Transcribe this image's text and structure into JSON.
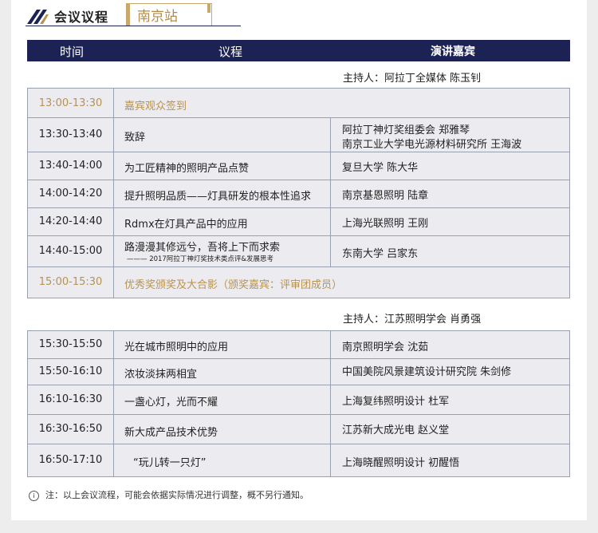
{
  "header": {
    "title": "会议议程",
    "city_tab": "南京站"
  },
  "table_header": {
    "time": "时间",
    "agenda": "议程",
    "speaker": "演讲嘉宾"
  },
  "session1": {
    "host": "主持人：阿拉丁全媒体  陈玉钊",
    "rows": [
      {
        "time": "13:00-13:30",
        "agenda": "嘉宾观众签到",
        "speakers": []
      },
      {
        "time": "13:30-13:40",
        "agenda": "致辞",
        "speakers": [
          "阿拉丁神灯奖组委会  郑雅琴",
          "南京工业大学电光源材料研究所  王海波"
        ]
      },
      {
        "time": "13:40-14:00",
        "agenda": "为工匠精神的照明产品点赞",
        "speakers": [
          "复旦大学  陈大华"
        ]
      },
      {
        "time": "14:00-14:20",
        "agenda": "提升照明品质——灯具研发的根本性追求",
        "speakers": [
          "南京基恩照明  陆章"
        ]
      },
      {
        "time": "14:20-14:40",
        "agenda": "Rdmx在灯具产品中的应用",
        "speakers": [
          "上海光联照明  王刚"
        ]
      },
      {
        "time": "14:40-15:00",
        "agenda": "路漫漫其修远兮，吾将上下而求索",
        "agenda_sub": "——— 2017阿拉丁神灯奖技术类点评&发展思考",
        "speakers": [
          "东南大学  吕家东"
        ]
      },
      {
        "time": "15:00-15:30",
        "agenda": "优秀奖颁奖及大合影（颁奖嘉宾：评审团成员）",
        "speakers": []
      }
    ]
  },
  "session2": {
    "host": "主持人：江苏照明学会  肖勇强",
    "rows": [
      {
        "time": "15:30-15:50",
        "agenda": "光在城市照明中的应用",
        "speakers": [
          "南京照明学会  沈茹"
        ]
      },
      {
        "time": "15:50-16:10",
        "agenda": "浓妆淡抹两相宜",
        "speakers": [
          "中国美院风景建筑设计研究院  朱剑修"
        ]
      },
      {
        "time": "16:10-16:30",
        "agenda": "一盏心灯，光而不耀",
        "speakers": [
          "上海复纬照明设计  杜军"
        ]
      },
      {
        "time": "16:30-16:50",
        "agenda": "新大成产品技术优势",
        "speakers": [
          "江苏新大成光电  赵义堂"
        ]
      },
      {
        "time": "16:50-17:10",
        "agenda": "“玩儿转一只灯”",
        "speakers": [
          "上海晓醒照明设计  初醒悟"
        ]
      }
    ]
  },
  "note": "注：以上会议流程，可能会依据实际情况进行调整，概不另行通知。",
  "colors": {
    "navy": "#1c2354",
    "gold": "#b8924e",
    "cell_bg": "#ececf0",
    "border": "#9aa0ad"
  }
}
